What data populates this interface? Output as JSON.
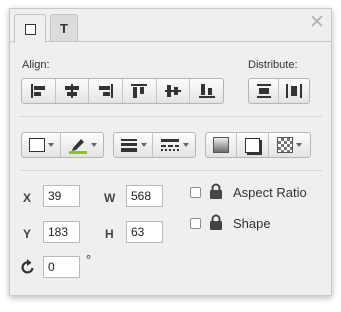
{
  "window": {
    "close_icon": "close-x-icon"
  },
  "tabs": [
    {
      "label": "",
      "icon": "shape-square-icon",
      "active": true
    },
    {
      "label": "T",
      "icon": "text-icon",
      "active": false
    }
  ],
  "align": {
    "label": "Align:",
    "buttons": [
      "align-left-icon",
      "align-center-horizontal-icon",
      "align-right-icon",
      "align-top-icon",
      "align-middle-vertical-icon",
      "align-bottom-icon"
    ]
  },
  "distribute": {
    "label": "Distribute:",
    "buttons": [
      "distribute-vertical-icon",
      "distribute-horizontal-icon"
    ]
  },
  "style_toolbar": {
    "fill_color": "#ffffff",
    "stroke_color": "#8dc21f",
    "buttons": [
      "fill-color-icon",
      "stroke-color-pen-icon",
      "line-weight-icon",
      "line-style-dashed-icon",
      "gradient-icon",
      "shadow-icon",
      "opacity-checker-icon"
    ]
  },
  "geometry": {
    "x": {
      "label": "X",
      "value": "39"
    },
    "y": {
      "label": "Y",
      "value": "183"
    },
    "w": {
      "label": "W",
      "value": "568"
    },
    "h": {
      "label": "H",
      "value": "63"
    },
    "rotation": {
      "icon": "rotate-icon",
      "value": "0",
      "unit": "°"
    }
  },
  "options": {
    "aspect_ratio": {
      "label": "Aspect Ratio",
      "checked": false,
      "icon": "lock-icon"
    },
    "shape": {
      "label": "Shape",
      "checked": false,
      "icon": "lock-icon"
    }
  }
}
